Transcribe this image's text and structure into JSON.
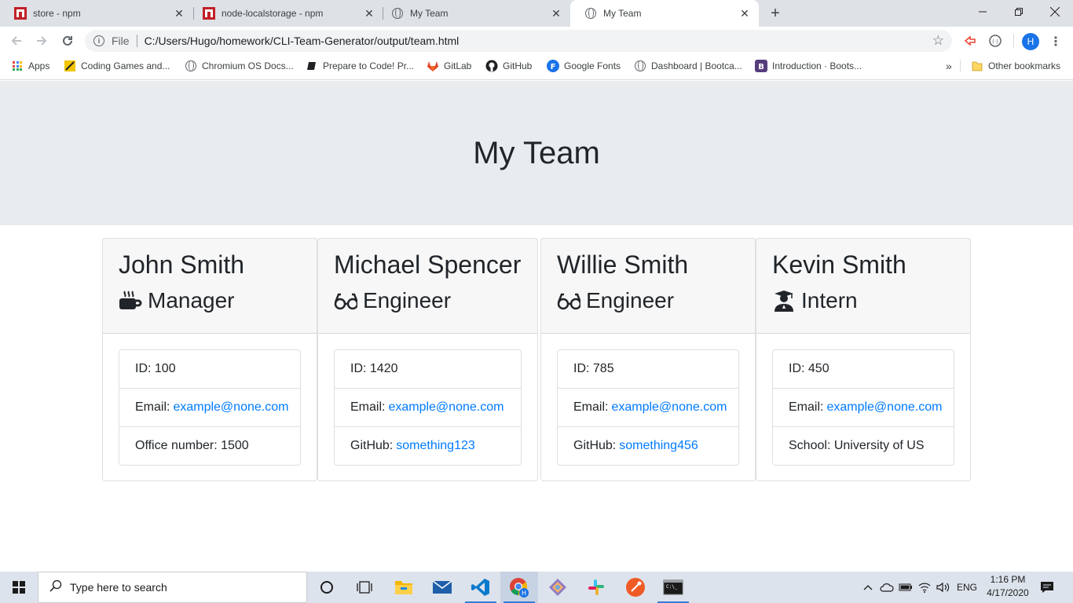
{
  "browser": {
    "tabs": [
      {
        "title": "store - npm",
        "favicon": "npm-icon",
        "active": false
      },
      {
        "title": "node-localstorage - npm",
        "favicon": "npm-icon",
        "active": false
      },
      {
        "title": "My Team",
        "favicon": "globe-icon",
        "active": false
      },
      {
        "title": "My Team",
        "favicon": "globe-icon",
        "active": true
      }
    ],
    "address": {
      "scheme_label": "File",
      "url": "C:/Users/Hugo/homework/CLI-Team-Generator/output/team.html"
    },
    "profile_initial": "H",
    "bookmarks": [
      {
        "label": "Apps",
        "icon": "apps-grid-icon"
      },
      {
        "label": "Coding Games and...",
        "icon": "coding-games-icon"
      },
      {
        "label": "Chromium OS Docs...",
        "icon": "globe-icon"
      },
      {
        "label": "Prepare to Code! Pr...",
        "icon": "book-icon"
      },
      {
        "label": "GitLab",
        "icon": "gitlab-icon"
      },
      {
        "label": "GitHub",
        "icon": "github-icon"
      },
      {
        "label": "Google Fonts",
        "icon": "google-fonts-icon"
      },
      {
        "label": "Dashboard | Bootca...",
        "icon": "globe-icon"
      },
      {
        "label": "Introduction · Boots...",
        "icon": "bootstrap-icon"
      }
    ],
    "bookmarks_overflow": "»",
    "other_bookmarks": "Other bookmarks"
  },
  "page": {
    "title": "My Team",
    "employees": [
      {
        "name": "John Smith",
        "role": "Manager",
        "role_icon": "mug-hot-icon",
        "id_label": "ID:",
        "id": "100",
        "email_label": "Email:",
        "email": "example@none.com",
        "extra_label": "Office number:",
        "extra_value": "1500",
        "extra_is_link": false
      },
      {
        "name": "Michael Spencer",
        "role": "Engineer",
        "role_icon": "glasses-icon",
        "id_label": "ID:",
        "id": "1420",
        "email_label": "Email:",
        "email": "example@none.com",
        "extra_label": "GitHub:",
        "extra_value": "something123",
        "extra_is_link": true
      },
      {
        "name": "Willie Smith",
        "role": "Engineer",
        "role_icon": "glasses-icon",
        "id_label": "ID:",
        "id": "785",
        "email_label": "Email:",
        "email": "example@none.com",
        "extra_label": "GitHub:",
        "extra_value": "something456",
        "extra_is_link": true
      },
      {
        "name": "Kevin Smith",
        "role": "Intern",
        "role_icon": "user-graduate-icon",
        "id_label": "ID:",
        "id": "450",
        "email_label": "Email:",
        "email": "example@none.com",
        "extra_label": "School:",
        "extra_value": "University of US",
        "extra_is_link": false
      }
    ]
  },
  "taskbar": {
    "search_placeholder": "Type here to search",
    "language": "ENG",
    "time": "1:16 PM",
    "date": "4/17/2020"
  },
  "colors": {
    "link": "#007bff",
    "jumbotron_bg": "#e9ecef",
    "accent": "#1a73e8"
  }
}
